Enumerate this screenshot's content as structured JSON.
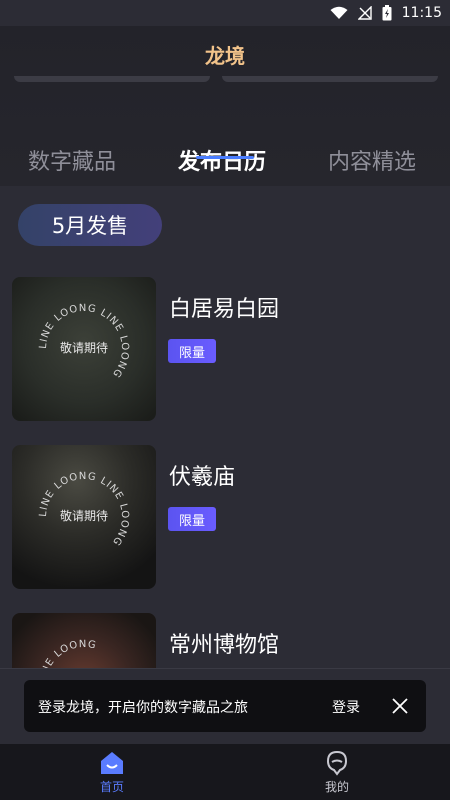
{
  "status_bar": {
    "time": "11:15",
    "icons": [
      "wifi-icon",
      "no-signal-icon",
      "battery-charging-icon"
    ]
  },
  "header": {
    "title": "龙境"
  },
  "tabs": [
    {
      "label": "数字藏品",
      "active": false
    },
    {
      "label": "发布日历",
      "active": true
    },
    {
      "label": "内容精选",
      "active": false
    }
  ],
  "calendar": {
    "month_label": "5月发售",
    "items": [
      {
        "name": "白居易白园",
        "badge": "限量",
        "ring_text": "LINE LOONG LINE LOONG",
        "placeholder": "敬请期待"
      },
      {
        "name": "伏羲庙",
        "badge": "限量",
        "ring_text": "LINE LOONG LINE LOONG",
        "placeholder": "敬请期待"
      },
      {
        "name": "常州博物馆",
        "ring_text": "LINE LOONG"
      }
    ]
  },
  "toast": {
    "message": "登录龙境，开启你的数字藏品之旅",
    "action": "登录"
  },
  "bottom_nav": [
    {
      "label": "首页",
      "icon": "home-icon",
      "active": true
    },
    {
      "label": "我的",
      "icon": "profile-icon",
      "active": false
    }
  ],
  "colors": {
    "accent": "#5a7cff",
    "title_gold": "#f2c38a",
    "badge": "#5b54f0",
    "background": "#2c2c35"
  }
}
